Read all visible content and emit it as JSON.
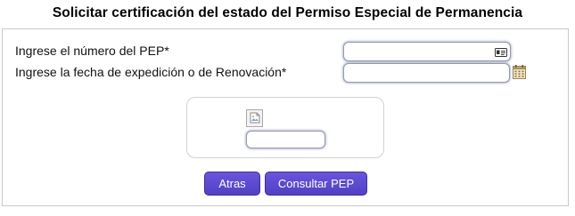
{
  "page": {
    "title": "Solicitar certificación del estado del Permiso Especial de Permanencia"
  },
  "form": {
    "pep_number_label": "Ingrese el número del PEP*",
    "pep_number_value": "",
    "issue_date_label": "Ingrese la fecha de expedición o de Renovación*",
    "issue_date_value": "",
    "captcha_value": ""
  },
  "icons": {
    "pep_field": "id-card-icon",
    "date_field": "calendar-icon",
    "captcha": "broken-image-icon"
  },
  "buttons": {
    "back_label": "Atras",
    "submit_label": "Consultar PEP"
  },
  "colors": {
    "button_bg": "#5a48d4",
    "button_text": "#ffffff",
    "input_focus_glow": "#788cc8"
  }
}
